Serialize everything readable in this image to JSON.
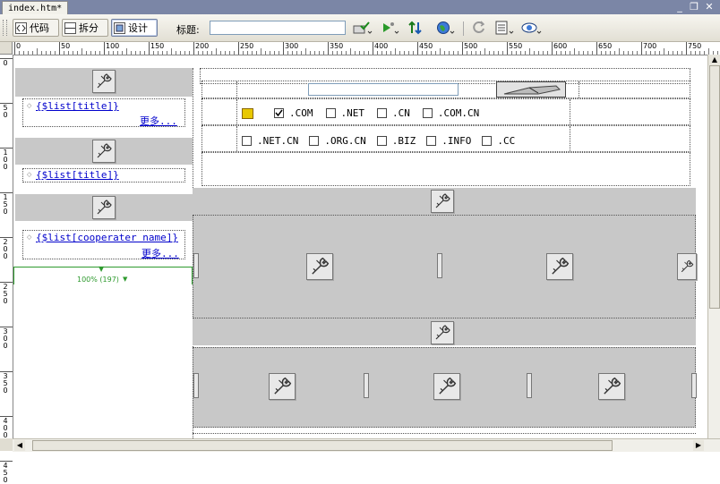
{
  "document_tab": {
    "label": "index.htm*"
  },
  "window_controls": {
    "minimize": "_",
    "restore": "❐",
    "close": "✕"
  },
  "toolbar": {
    "code_label": "代码",
    "split_label": "拆分",
    "design_label": "设计",
    "title_label": "标题:",
    "title_value": ""
  },
  "ruler": {
    "h_ticks": [
      "0",
      "50",
      "100",
      "150",
      "200",
      "250",
      "300",
      "350",
      "400",
      "450",
      "500",
      "550",
      "600",
      "650",
      "700",
      "750"
    ],
    "v_ticks": [
      "0",
      "5\n0",
      "1\n0\n0",
      "1\n5\n0",
      "2\n0\n0",
      "2\n5\n0",
      "3\n0\n0",
      "3\n5\n0",
      "4\n0\n0",
      "4\n5\n0"
    ]
  },
  "left_panel": {
    "item1_title": "{$list[title]}",
    "item1_more": "更多...",
    "item2_title": "{$list[title]}",
    "item3_title": "{$list[cooperater name]}",
    "item3_more": "更多...",
    "width_indicator": "100% (197)"
  },
  "domain_form": {
    "search_input_value": "",
    "row1": [
      {
        "label": ".COM",
        "checked": true
      },
      {
        "label": ".NET",
        "checked": false
      },
      {
        "label": ".CN",
        "checked": false
      },
      {
        "label": ".COM.CN",
        "checked": false
      }
    ],
    "row2": [
      {
        "label": ".NET.CN",
        "checked": false
      },
      {
        "label": ".ORG.CN",
        "checked": false
      },
      {
        "label": ".BIZ",
        "checked": false
      },
      {
        "label": ".INFO",
        "checked": false
      },
      {
        "label": ".CC",
        "checked": false
      }
    ]
  },
  "colors": {
    "tab_strip": "#7b86a6",
    "placeholder_gray": "#c8c8c8",
    "link_blue": "#0000cc",
    "width_indicator_green": "#2e9a2e"
  }
}
